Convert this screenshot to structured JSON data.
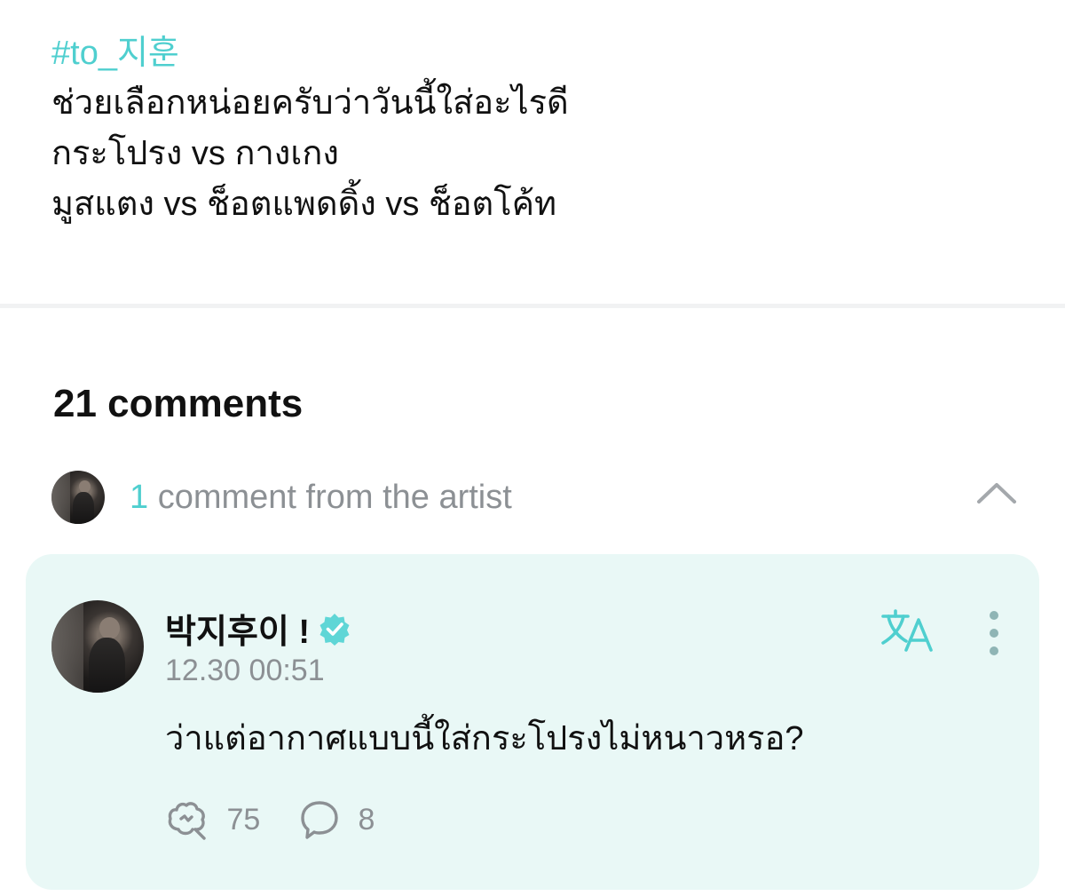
{
  "post": {
    "hashtag": "#to_지훈",
    "lines": [
      "ช่วยเลือกหน่อยครับว่าวันนี้ใส่อะไรดี",
      "กระโปรง vs กางเกง",
      "มูสแตง vs ช็อตแพดดิ้ง vs ช็อตโค้ท"
    ]
  },
  "comments_header": {
    "label": "21 comments"
  },
  "artist_comments": {
    "count": "1",
    "label": " comment from the artist",
    "toggle_icon": "chevron-up-icon"
  },
  "comment": {
    "author": "박지후이 !",
    "verified_icon": "verified-badge-icon",
    "timestamp": "12.30 00:51",
    "text": "ว่าแต่อากาศแบบนี้ใส่กระโปรงไม่หนาวหรอ?",
    "translate_icon": "translate-icon",
    "more_icon": "more-vertical-icon",
    "likes": "75",
    "replies": "8"
  },
  "colors": {
    "accent": "#4fcfcf",
    "card_background": "#e9f8f6",
    "muted_text": "#8c9094"
  }
}
